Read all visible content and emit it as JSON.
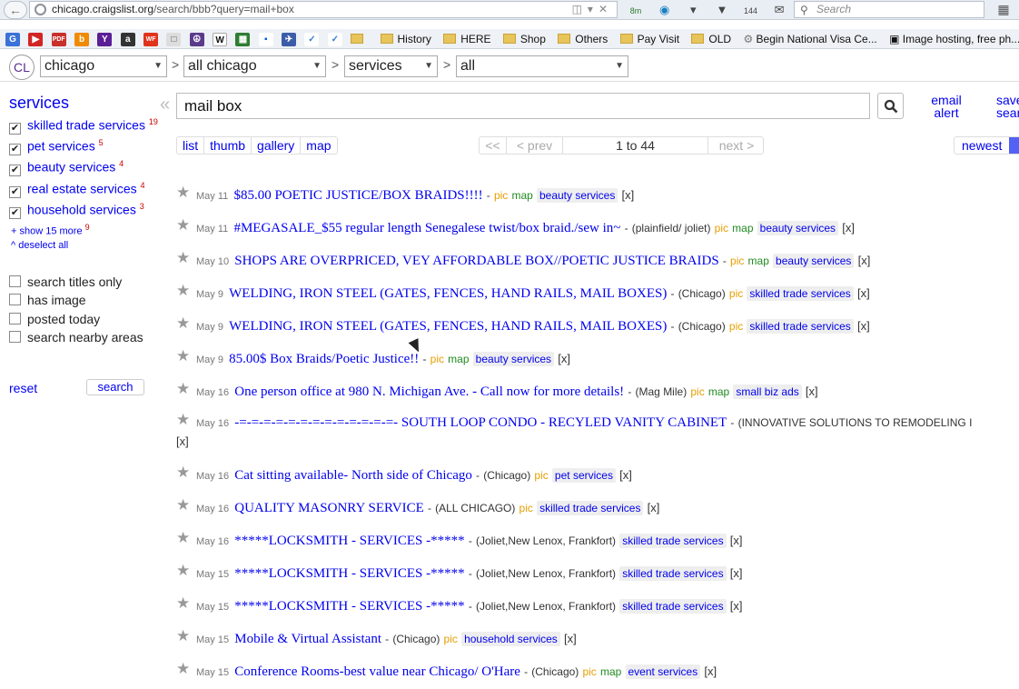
{
  "browser": {
    "url_host": "chicago.craigslist.org",
    "url_path": "/search/bbb?query=mail+box",
    "search_placeholder": "Search",
    "toolbar_badge_1": "8m",
    "toolbar_badge_2": "144"
  },
  "bookmarks": {
    "icons": [
      "G",
      "▶",
      "PDF",
      "b",
      "Y",
      "a",
      "WF",
      "□",
      "☮",
      "W",
      "▦",
      "▪",
      "✈",
      "✓",
      "✓"
    ],
    "folders": [
      "History",
      "HERE",
      "Shop",
      "Others",
      "Pay Visit",
      "OLD"
    ],
    "links": [
      "Begin National Visa Ce...",
      "Image hosting, free ph..."
    ]
  },
  "cl_header": {
    "logo": "CL",
    "city": "chicago",
    "area": "all chicago",
    "section": "services",
    "subsection": "all",
    "separator": ">"
  },
  "sidebar": {
    "title": "services",
    "categories": [
      {
        "label": "skilled trade services",
        "count": "19",
        "checked": true
      },
      {
        "label": "pet services",
        "count": "5",
        "checked": true
      },
      {
        "label": "beauty services",
        "count": "4",
        "checked": true
      },
      {
        "label": "real estate services",
        "count": "4",
        "checked": true
      },
      {
        "label": "household services",
        "count": "3",
        "checked": true
      }
    ],
    "show_more": "+ show 15 more",
    "show_more_count": "9",
    "deselect_all": "^ deselect all",
    "options": [
      {
        "label": "search titles only",
        "checked": false
      },
      {
        "label": "has image",
        "checked": false
      },
      {
        "label": "posted today",
        "checked": false
      },
      {
        "label": "search nearby areas",
        "checked": false
      }
    ],
    "reset": "reset",
    "search": "search"
  },
  "search": {
    "query": "mail box",
    "email_alert": "email alert",
    "save_search": "save search"
  },
  "view": {
    "modes": [
      "list",
      "thumb",
      "gallery",
      "map"
    ],
    "first": "<<",
    "prev": "< prev",
    "range": "1 to 44",
    "next": "next >",
    "sort": "newest"
  },
  "results": [
    {
      "date": "May 11",
      "title": "$85.00 POETIC JUSTICE/BOX BRAIDS!!!!",
      "hood": "",
      "pic": true,
      "map": true,
      "category": "beauty services"
    },
    {
      "date": "May 11",
      "title": "#MEGASALE_$55 regular length Senegalese twist/box braid./sew in~",
      "hood": "(plainfield/ joliet)",
      "pic": true,
      "map": true,
      "category": "beauty services"
    },
    {
      "date": "May 10",
      "title": "SHOPS ARE OVERPRICED, VEY AFFORDABLE BOX//POETIC JUSTICE BRAIDS",
      "hood": "",
      "pic": true,
      "map": true,
      "category": "beauty services"
    },
    {
      "date": "May 9",
      "title": "WELDING, IRON STEEL (GATES, FENCES, HAND RAILS, MAIL BOXES)",
      "hood": "(Chicago)",
      "pic": true,
      "map": false,
      "category": "skilled trade services"
    },
    {
      "date": "May 9",
      "title": "WELDING, IRON STEEL (GATES, FENCES, HAND RAILS, MAIL BOXES)",
      "hood": "(Chicago)",
      "pic": true,
      "map": false,
      "category": "skilled trade services"
    },
    {
      "date": "May 9",
      "title": "85.00$ Box Braids/Poetic Justice!!",
      "hood": "",
      "pic": true,
      "map": true,
      "category": "beauty services"
    },
    {
      "date": "May 16",
      "title": "One person office at 980 N. Michigan Ave. - Call now for more details!",
      "hood": "(Mag Mile)",
      "pic": true,
      "map": true,
      "category": "small biz ads"
    },
    {
      "date": "May 16",
      "title": "-=-=-=-=-=-=-=-=-=-=-=-=-=- SOUTH LOOP CONDO - RECYLED VANITY CABINET",
      "hood": "(INNOVATIVE SOLUTIONS TO REMODELING I",
      "pic": false,
      "map": false,
      "category": ""
    },
    {
      "date": "May 16",
      "title": "Cat sitting available- North side of Chicago",
      "hood": "(Chicago)",
      "pic": true,
      "map": false,
      "category": "pet services"
    },
    {
      "date": "May 16",
      "title": "QUALITY MASONRY SERVICE",
      "hood": "(ALL CHICAGO)",
      "pic": true,
      "map": false,
      "category": "skilled trade services"
    },
    {
      "date": "May 16",
      "title": "*****LOCKSMITH - SERVICES -*****",
      "hood": "(Joliet,New Lenox, Frankfort)",
      "pic": false,
      "map": false,
      "category": "skilled trade services"
    },
    {
      "date": "May 15",
      "title": "*****LOCKSMITH - SERVICES -*****",
      "hood": "(Joliet,New Lenox, Frankfort)",
      "pic": false,
      "map": false,
      "category": "skilled trade services"
    },
    {
      "date": "May 15",
      "title": "*****LOCKSMITH - SERVICES -*****",
      "hood": "(Joliet,New Lenox, Frankfort)",
      "pic": false,
      "map": false,
      "category": "skilled trade services"
    },
    {
      "date": "May 15",
      "title": "Mobile & Virtual Assistant",
      "hood": "(Chicago)",
      "pic": true,
      "map": false,
      "category": "household services"
    },
    {
      "date": "May 15",
      "title": "Conference Rooms-best value near Chicago/ O'Hare",
      "hood": "(Chicago)",
      "pic": true,
      "map": true,
      "category": "event services"
    }
  ],
  "labels": {
    "pic": "pic",
    "map": "map",
    "hide": "[x]",
    "dash": "-"
  }
}
